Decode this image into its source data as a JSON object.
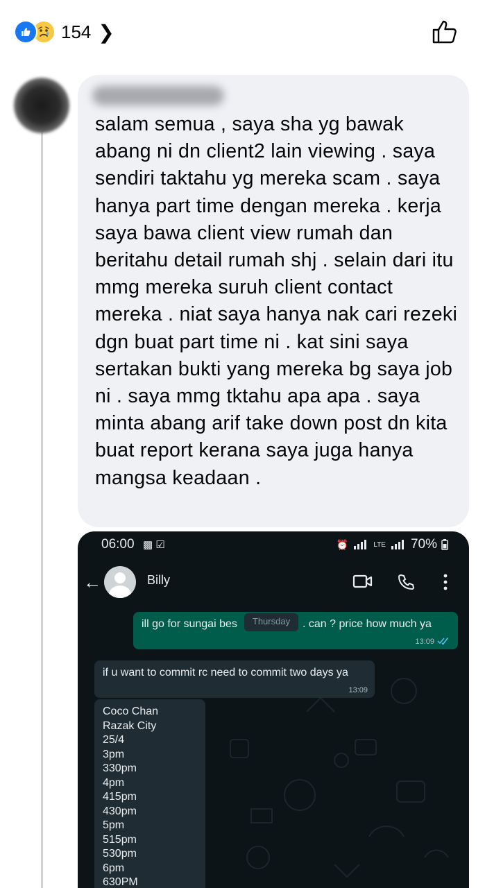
{
  "reactions": {
    "count": "154",
    "types": [
      "like",
      "sad"
    ],
    "colors": {
      "like": "#1877f2",
      "sad": "#f7c843"
    }
  },
  "comment": {
    "author_name": "",
    "text": "salam semua , saya sha yg bawak abang ni dn client2 lain viewing . saya sendiri taktahu yg mereka scam . saya hanya part time dengan mereka . kerja saya bawa client view rumah dan beritahu detail rumah shj . selain dari itu mmg mereka suruh client contact mereka . niat saya hanya nak cari rezeki dgn buat part time ni . kat sini saya sertakan bukti yang mereka bg saya job ni . saya mmg tktahu apa apa . saya minta abang arif take down post dn kita buat report kerana saya juga hanya mangsa keadaan ."
  },
  "screenshot": {
    "status_bar": {
      "time": "06:00",
      "battery": "70%"
    },
    "chat": {
      "contact_name": "Billy",
      "messages": [
        {
          "direction": "out",
          "text_part1": "ill go for sungai bes",
          "text_part2": ". can ? price how much ya",
          "time": "13:09",
          "read": true
        },
        {
          "direction": "in",
          "text": "if u want to commit rc need to commit two days ya",
          "time": "13:09"
        },
        {
          "direction": "in",
          "lines": [
            "Coco Chan",
            "Razak City",
            "25/4",
            "3pm",
            "330pm",
            "4pm",
            "415pm",
            "430pm",
            "5pm",
            "515pm",
            "530pm",
            "6pm",
            "630PM"
          ]
        }
      ],
      "date_chip": "Thursday"
    },
    "colors": {
      "background": "#0d1418",
      "outgoing": "#005c4b",
      "incoming": "#1f2c34",
      "read_ticks": "#53bdeb"
    }
  }
}
